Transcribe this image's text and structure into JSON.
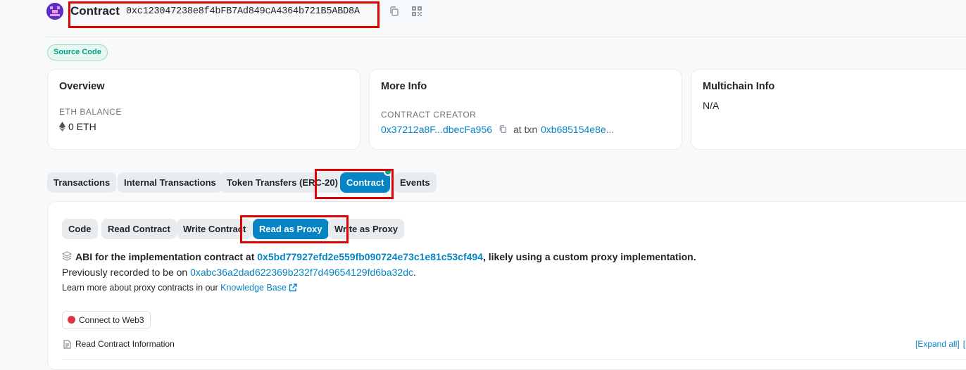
{
  "header": {
    "title": "Contract",
    "address": "0xc123047238e8f4bFB7Ad849cA4364b721B5ABD8A",
    "copy_icon": "copy-icon",
    "qr_icon": "qr-code-icon"
  },
  "badge": {
    "label": "Source Code"
  },
  "overview": {
    "title": "Overview",
    "balance_label": "ETH BALANCE",
    "balance_value": "0 ETH",
    "eth_icon": "ethereum-icon"
  },
  "more_info": {
    "title": "More Info",
    "creator_label": "CONTRACT CREATOR",
    "creator_address": "0x37212a8F...dbecFa956",
    "at_txn_label": "at txn",
    "txn_hash": "0xb685154e8e..."
  },
  "multichain": {
    "title": "Multichain Info",
    "value": "N/A"
  },
  "tabs": [
    {
      "label": "Transactions"
    },
    {
      "label": "Internal Transactions"
    },
    {
      "label": "Token Transfers (ERC-20)"
    },
    {
      "label": "Contract",
      "active": true
    },
    {
      "label": "Events"
    }
  ],
  "subtabs": [
    {
      "label": "Code"
    },
    {
      "label": "Read Contract"
    },
    {
      "label": "Write Contract"
    },
    {
      "label": "Read as Proxy",
      "active": true
    },
    {
      "label": "Write as Proxy"
    }
  ],
  "proxy": {
    "abi_prefix": "ABI for the implementation contract at ",
    "impl_address": "0x5bd77927efd2e559fb090724e73c1e81c53cf494",
    "abi_suffix": ", likely using a custom proxy implementation.",
    "prev_prefix": "Previously recorded to be on ",
    "prev_address": "0xabc36a2dad622369b232f7d49654129fd6ba32dc",
    "prev_suffix": ".",
    "learn_prefix": "Learn more about proxy contracts in our ",
    "learn_link": "Knowledge Base"
  },
  "connect": {
    "label": "Connect to Web3"
  },
  "read_info": {
    "label": "Read Contract Information"
  },
  "expand": {
    "label": "[Expand all]",
    "extra": "["
  },
  "colors": {
    "accent": "#0784c3",
    "highlight_box": "#e00000",
    "badge_green": "#00a186",
    "connect_dot": "#dc3545"
  }
}
